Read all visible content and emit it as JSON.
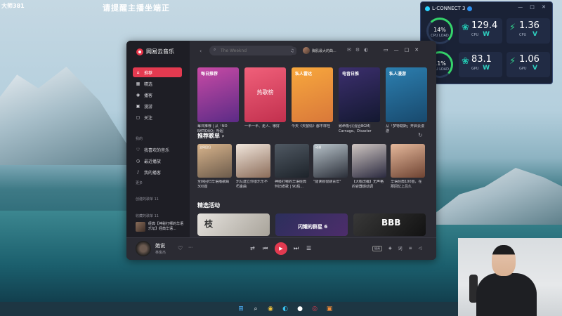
{
  "overlay": {
    "streamer_tag": "大师381",
    "notice": "请提醒主播坐端正"
  },
  "lconnect": {
    "title": "L-CONNECT 3",
    "cpu": {
      "load_pct": "14%",
      "load_label": "CPU LOAD",
      "temp": "129.4",
      "temp_label": "CPU",
      "temp_unit": "W",
      "power": "1.36",
      "power_label": "CPU",
      "power_unit": "V"
    },
    "gpu": {
      "load_pct": "11%",
      "load_label": "GPU LOAD",
      "temp": "83.1",
      "temp_label": "GPU",
      "temp_unit": "W",
      "power": "1.06",
      "power_label": "GPU",
      "power_unit": "V"
    }
  },
  "app": {
    "brand": "网易云音乐",
    "search": {
      "placeholder": "The Weeknd",
      "value": ""
    },
    "user_name": "胸肌最大的曲...",
    "nav": [
      {
        "label": "推荐",
        "icon": "home-icon",
        "active": true
      },
      {
        "label": "精选",
        "icon": "grid-icon",
        "active": false
      },
      {
        "label": "播客",
        "icon": "podcast-icon",
        "active": false
      },
      {
        "label": "漫游",
        "icon": "radio-icon",
        "active": false
      },
      {
        "label": "关注",
        "icon": "follow-icon",
        "active": false
      }
    ],
    "my_section": "我的",
    "my_items": [
      {
        "label": "我喜欢的音乐",
        "icon": "heart-icon"
      },
      {
        "label": "最近播放",
        "icon": "clock-icon"
      },
      {
        "label": "我的播客",
        "icon": "mic-icon"
      }
    ],
    "more_label": "更多",
    "created_playlists": "创建的歌单 11",
    "collected_playlists": "收藏的歌单 11",
    "sidebar_playlist": "经典【神秘打哪的华语乐坛】经典华语...",
    "top_cards": [
      {
        "title": "每日推荐",
        "middle": "",
        "caption": "每日推荐 | 从「NO BATIDÃO」听起",
        "color1": "#c84aa5",
        "color2": "#5b2b86"
      },
      {
        "title": "",
        "middle": "热歌榜",
        "caption": "一半一半、走人、哪好",
        "color1": "#f0607a",
        "color2": "#c2304e"
      },
      {
        "title": "私人雷达",
        "middle": "",
        "caption": "今天《天窗情》都不样哇",
        "color1": "#f8a83d",
        "color2": "#d9783a"
      },
      {
        "title": "电音日推",
        "middle": "",
        "caption": "致命吸引(混合BGM) Carnage、Disaster",
        "color1": "#3c2f6e",
        "color2": "#131830"
      },
      {
        "title": "私人漫游",
        "middle": "",
        "caption": "从「梦特勒斯」开启云漫游",
        "color1": "#2c7fb0",
        "color2": "#18496d"
      }
    ],
    "recommended_title": "推荐歌单 ›",
    "playlists": [
      {
        "tag": "全网回归",
        "caption": "全网回归华语播歌曲300首",
        "color1": "#d8b48c",
        "color2": "#6c5b4b"
      },
      {
        "tag": "",
        "caption": "乐队建立你很乐乐不朽金曲",
        "color1": "#f1e6dc",
        "color2": "#8b6c59"
      },
      {
        "tag": "",
        "caption": "神级打哪的华语经典怀旧老歌 | 90后...",
        "color1": "#505963",
        "color2": "#1d232a"
      },
      {
        "tag": "动漫",
        "caption": "\"能读就很跳青年\"",
        "color1": "#b8c3ca",
        "color2": "#2b2f39"
      },
      {
        "tag": "",
        "caption": "【大眼改编】无声格的容器感动调",
        "color1": "#cfc6c2",
        "color2": "#2b2a3f"
      },
      {
        "tag": "",
        "caption": "华语经典100首，在那回忆上吕久",
        "color1": "#e5b89b",
        "color2": "#6e4332"
      }
    ],
    "activities_title": "精选活动",
    "activities": [
      {
        "title": "枝",
        "color1": "#e6e3de",
        "color2": "#a8a39a"
      },
      {
        "title": "闪耀的群星 6",
        "color1": "#2c2f5c",
        "color2": "#4d2d6b"
      },
      {
        "title": "BBB",
        "color1": "#383838",
        "color2": "#121212"
      }
    ],
    "player": {
      "title": "她说",
      "artist": "林俊杰",
      "quality": "极高"
    }
  }
}
